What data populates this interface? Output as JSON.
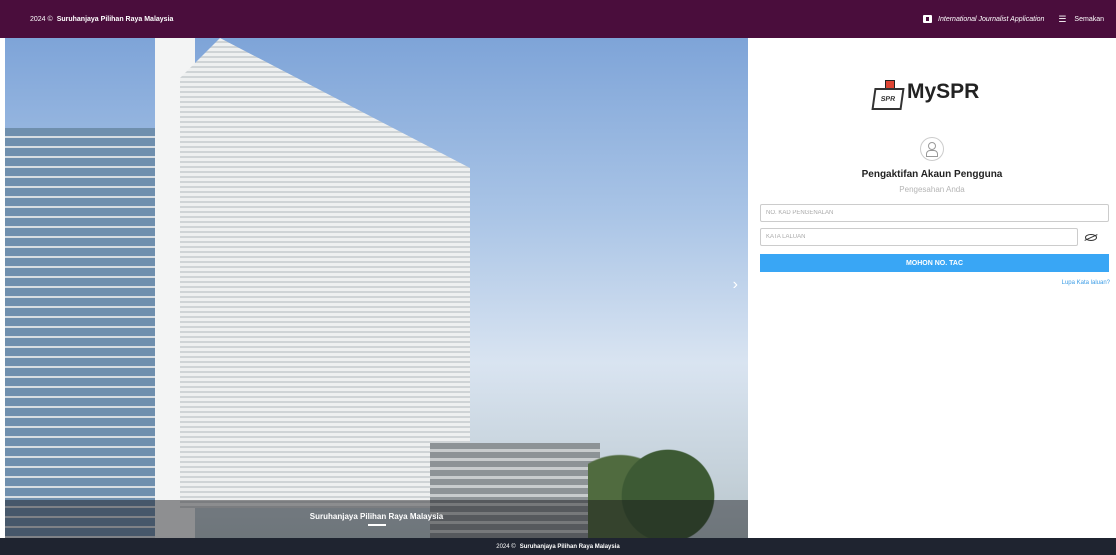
{
  "topbar": {
    "year": "2024 ©",
    "org": "Suruhanjaya Pilihan Raya Malaysia",
    "link_journalist": "International Journalist Application",
    "link_semakan": "Semakan"
  },
  "hero": {
    "caption": "Suruhanjaya Pilihan Raya Malaysia",
    "next": "›"
  },
  "panel": {
    "logo_text": "MySPR",
    "logo_badge": "SPR",
    "title": "Pengaktifan Akaun Pengguna",
    "subtitle": "Pengesahan Anda",
    "ic_placeholder": "NO. KAD PENGENALAN",
    "pw_placeholder": "KATA LALUAN",
    "button": "MOHON NO. TAC",
    "forgot": "Lupa Kata laluan?"
  },
  "footer": {
    "year": "2024 ©",
    "org": "Suruhanjaya Pilihan Raya Malaysia"
  },
  "colors": {
    "topbar": "#4a0d3c",
    "button": "#39a6f5",
    "footer": "#1f2430",
    "link": "#3b9ce6"
  }
}
